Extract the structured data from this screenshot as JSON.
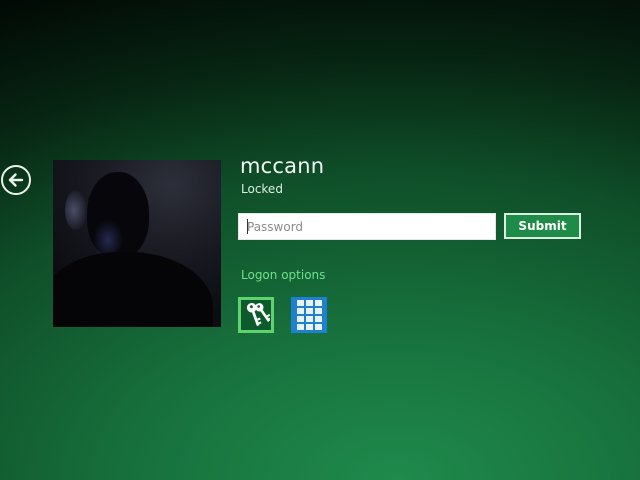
{
  "user": {
    "name": "mccann",
    "status": "Locked"
  },
  "password": {
    "placeholder": "Password",
    "value": ""
  },
  "submit_label": "Submit",
  "logon_options_label": "Logon options",
  "logon_options": [
    {
      "icon": "password-key-icon",
      "selected": true
    },
    {
      "icon": "pin-keypad-icon",
      "selected": false
    }
  ],
  "icons": {
    "back": "back-arrow-icon"
  },
  "colors": {
    "background": "#17703c",
    "submit": "#1e8b48",
    "link": "#6fe08a",
    "selected_border": "#5fd36d",
    "pin_tile": "#1f7fd0"
  }
}
